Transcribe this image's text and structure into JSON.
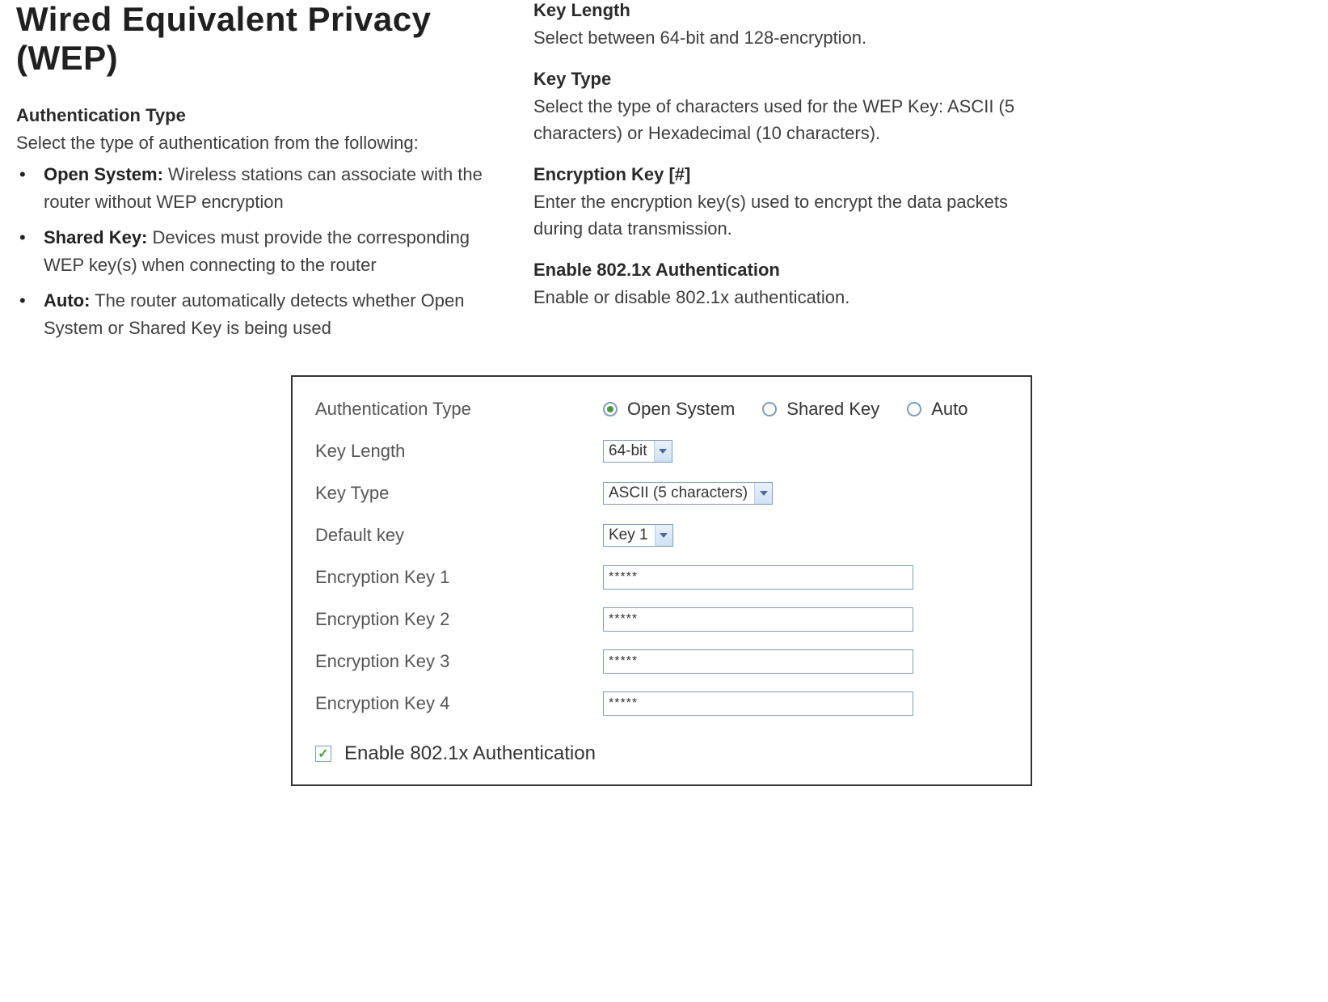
{
  "page": {
    "title": "Wired Equivalent Privacy (WEP)"
  },
  "left": {
    "auth_type": {
      "heading": "Authentication Type",
      "intro": "Select the type of authentication from the following:",
      "items": [
        {
          "lead": "Open System:",
          "body": " Wireless stations can associate with the router without WEP encryption"
        },
        {
          "lead": "Shared Key:",
          "body": " Devices must provide the corresponding WEP key(s) when connecting to the router"
        },
        {
          "lead": "Auto:",
          "body": " The router automatically detects whether Open System or Shared Key is being used"
        }
      ]
    }
  },
  "right": {
    "key_length": {
      "heading": "Key Length",
      "body": "Select between 64-bit and 128-encryption."
    },
    "key_type": {
      "heading": "Key Type",
      "body": "Select the type of characters used for the WEP Key: ASCII (5 characters) or Hexadecimal (10 characters)."
    },
    "enc_key": {
      "heading": "Encryption Key [#]",
      "body": "Enter the encryption key(s) used to encrypt the data packets during data transmission."
    },
    "enable_8021x": {
      "heading": "Enable 802.1x Authentication",
      "body": "Enable or disable 802.1x authentication."
    }
  },
  "panel": {
    "labels": {
      "auth_type": "Authentication Type",
      "key_length": "Key Length",
      "key_type": "Key Type",
      "default_key": "Default key",
      "ek1": "Encryption Key 1",
      "ek2": "Encryption Key 2",
      "ek3": "Encryption Key 3",
      "ek4": "Encryption Key 4"
    },
    "radios": {
      "open": "Open System",
      "shared": "Shared Key",
      "auto": "Auto",
      "selected": "open"
    },
    "selects": {
      "key_length": "64-bit",
      "key_type": "ASCII (5 characters)",
      "default_key": "Key 1"
    },
    "inputs": {
      "ek1": "*****",
      "ek2": "*****",
      "ek3": "*****",
      "ek4": "*****"
    },
    "checkbox": {
      "label": "Enable 802.1x Authentication",
      "checked": true
    }
  }
}
